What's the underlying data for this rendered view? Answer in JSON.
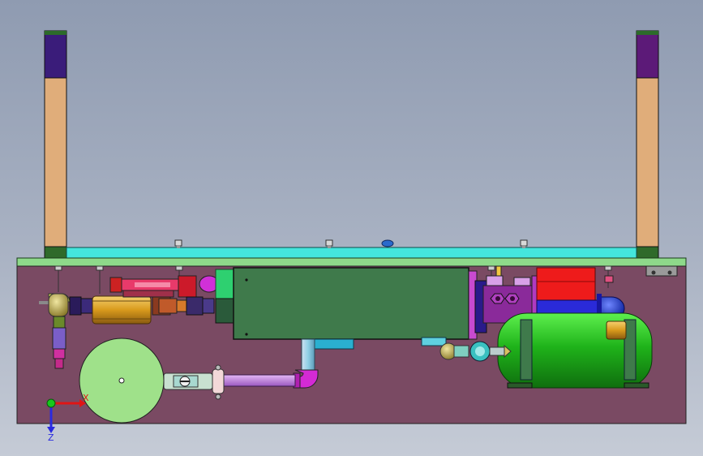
{
  "viewport": {
    "background_top": "#8f9bb1",
    "background_bottom": "#c5cbd6"
  },
  "triad": {
    "x_label": "X",
    "z_label": "Z",
    "x_color": "#e01515",
    "y_color": "#16c81c",
    "z_color": "#2a2ae0"
  },
  "colors": {
    "frame": "#7a4a63",
    "top_plate": "#8ed98a",
    "cyan_beam": "#44e6dc",
    "posts": "#e0ad7a",
    "post_cap_left": "#3a1c7a",
    "post_cap_right": "#5c1a78",
    "control_box": "#3f7a4b",
    "tank": "#22b31c",
    "disk": "#9fe18a",
    "red_box": "#ee1b1b"
  }
}
